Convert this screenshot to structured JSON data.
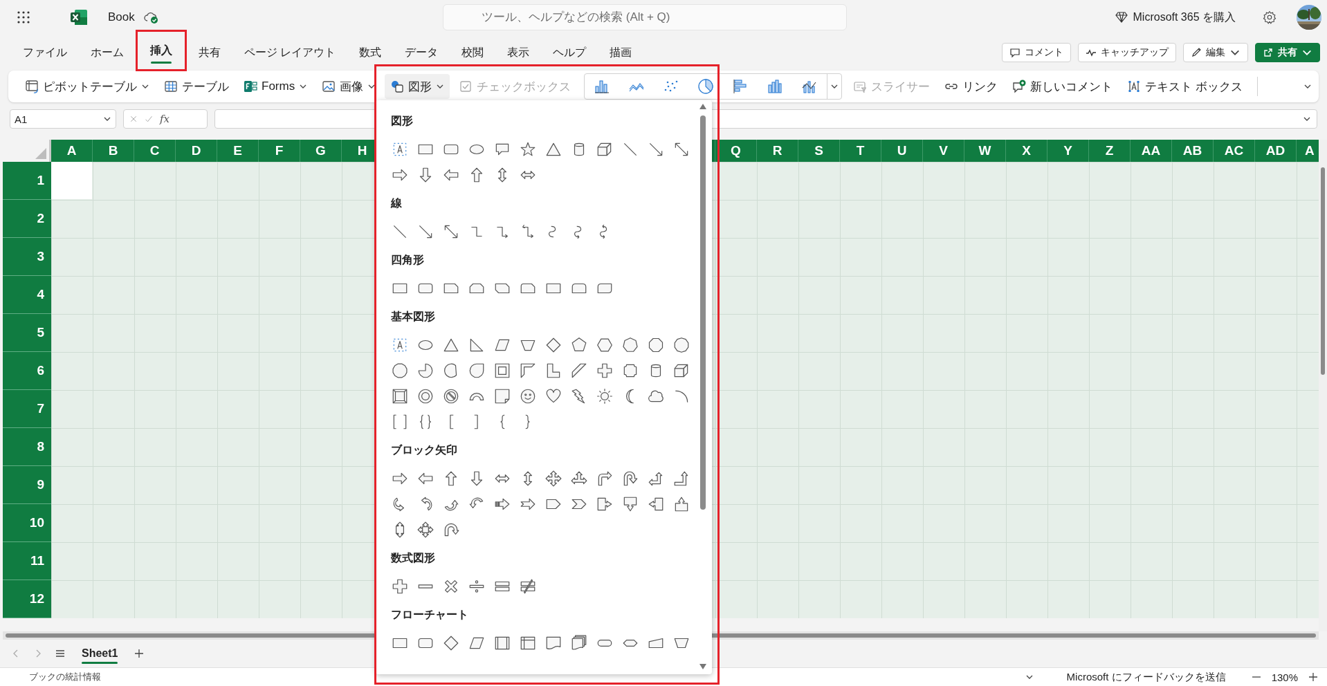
{
  "app_bar": {
    "title": "Book",
    "search": {
      "placeholder": "ツール、ヘルプなどの検索 (Alt + Q)"
    },
    "buy_label": "Microsoft 365 を購入"
  },
  "menu_tabs": [
    {
      "label": "ファイル",
      "selected": false,
      "highlighted": false
    },
    {
      "label": "ホーム",
      "selected": false,
      "highlighted": false
    },
    {
      "label": "挿入",
      "selected": true,
      "highlighted": true
    },
    {
      "label": "共有",
      "selected": false,
      "highlighted": false
    },
    {
      "label": "ページ レイアウト",
      "selected": false,
      "highlighted": false
    },
    {
      "label": "数式",
      "selected": false,
      "highlighted": false
    },
    {
      "label": "データ",
      "selected": false,
      "highlighted": false
    },
    {
      "label": "校閲",
      "selected": false,
      "highlighted": false
    },
    {
      "label": "表示",
      "selected": false,
      "highlighted": false
    },
    {
      "label": "ヘルプ",
      "selected": false,
      "highlighted": false
    },
    {
      "label": "描画",
      "selected": false,
      "highlighted": false
    }
  ],
  "header_buttons": [
    {
      "label": "コメント",
      "kind": "outline"
    },
    {
      "label": "キャッチアップ",
      "kind": "outline"
    },
    {
      "label": "編集",
      "kind": "dropdown"
    },
    {
      "label": "共有",
      "kind": "primary"
    }
  ],
  "ribbon": {
    "items": [
      {
        "label": "ピボットテーブル",
        "dropdown": true,
        "disabled": false,
        "expanded": false
      },
      {
        "label": "テーブル",
        "dropdown": false,
        "disabled": false,
        "expanded": false
      },
      {
        "label": "Forms",
        "dropdown": true,
        "disabled": false,
        "expanded": false
      },
      {
        "label": "画像",
        "dropdown": true,
        "disabled": false,
        "expanded": false
      },
      {
        "label": "図形",
        "dropdown": true,
        "disabled": false,
        "expanded": true
      },
      {
        "label": "チェックボックス",
        "dropdown": false,
        "disabled": true,
        "expanded": false
      }
    ],
    "items_after": [
      {
        "label": "スライサー",
        "disabled": true
      },
      {
        "label": "リンク",
        "disabled": false
      },
      {
        "label": "新しいコメント",
        "disabled": false
      },
      {
        "label": "テキスト ボックス",
        "disabled": false
      }
    ]
  },
  "formula_bar": {
    "name_box": "A1",
    "function_label": "fx"
  },
  "grid": {
    "columns_left": [
      "A",
      "B",
      "C",
      "D",
      "E",
      "F",
      "G",
      "H"
    ],
    "columns_right": [
      "Q",
      "R",
      "S",
      "T",
      "U",
      "V",
      "W",
      "X",
      "Y",
      "Z",
      "AA",
      "AB",
      "AC",
      "AD",
      "A"
    ],
    "rows": [
      "1",
      "2",
      "3",
      "4",
      "5",
      "6",
      "7",
      "8",
      "9",
      "10",
      "11",
      "12"
    ]
  },
  "shapes_panel": {
    "highlighted": true,
    "sections": [
      {
        "title": "図形"
      },
      {
        "title": "線"
      },
      {
        "title": "四角形"
      },
      {
        "title": "基本図形"
      },
      {
        "title": "ブロック矢印"
      },
      {
        "title": "数式図形"
      },
      {
        "title": "フローチャート"
      }
    ]
  },
  "sheet_tabs": [
    {
      "label": "Sheet1",
      "selected": true
    }
  ],
  "status_bar": {
    "left": "ブックの統計情報",
    "feedback": "Microsoft にフィードバックを送信",
    "zoom": "130%"
  }
}
